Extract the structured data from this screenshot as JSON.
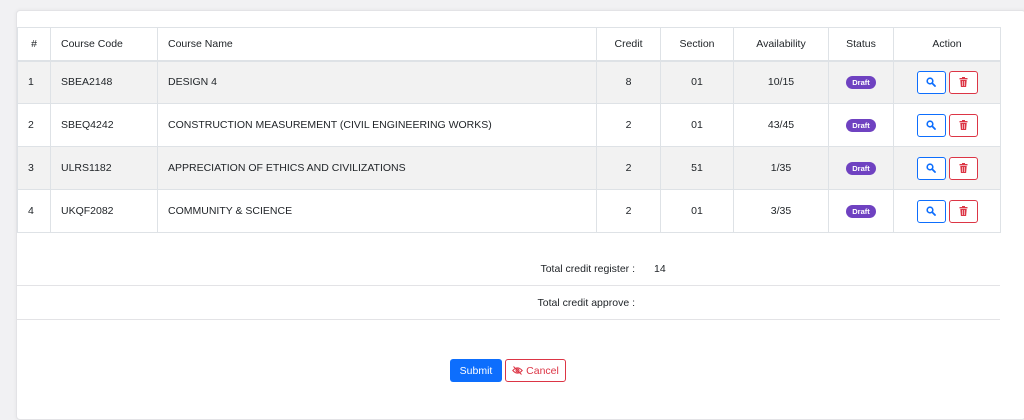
{
  "table": {
    "headers": {
      "index": "#",
      "code": "Course Code",
      "name": "Course Name",
      "credit": "Credit",
      "section": "Section",
      "availability": "Availability",
      "status": "Status",
      "action": "Action"
    },
    "rows": [
      {
        "index": "1",
        "code": "SBEA2148",
        "name": "DESIGN 4",
        "credit": "8",
        "section": "01",
        "availability": "10/15",
        "status": "Draft"
      },
      {
        "index": "2",
        "code": "SBEQ4242",
        "name": "CONSTRUCTION MEASUREMENT (CIVIL ENGINEERING WORKS)",
        "credit": "2",
        "section": "01",
        "availability": "43/45",
        "status": "Draft"
      },
      {
        "index": "3",
        "code": "ULRS1182",
        "name": "APPRECIATION OF ETHICS AND CIVILIZATIONS",
        "credit": "2",
        "section": "51",
        "availability": "1/35",
        "status": "Draft"
      },
      {
        "index": "4",
        "code": "UKQF2082",
        "name": "COMMUNITY & SCIENCE",
        "credit": "2",
        "section": "01",
        "availability": "3/35",
        "status": "Draft"
      }
    ],
    "view_icon": "search-icon",
    "delete_icon": "trash-icon"
  },
  "summary": {
    "register_label": "Total credit register :",
    "register_value": "14",
    "approve_label": "Total credit approve :",
    "approve_value": ""
  },
  "buttons": {
    "submit": "Submit",
    "cancel": "Cancel",
    "cancel_icon": "eye-slash-icon"
  },
  "colors": {
    "primary": "#0d6efd",
    "danger": "#dc3545",
    "badge": "#6f42c1"
  }
}
